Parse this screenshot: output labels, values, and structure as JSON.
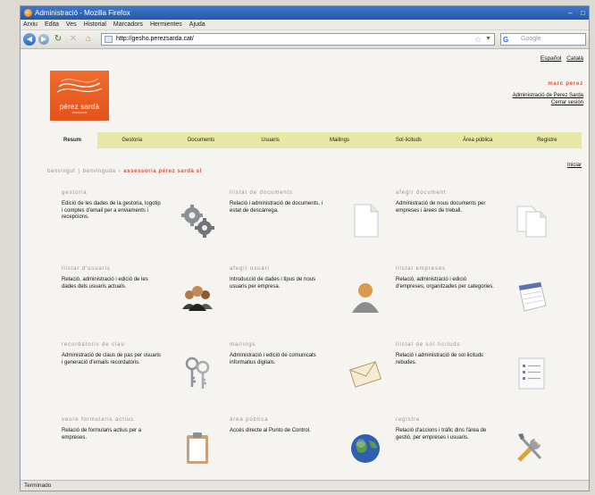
{
  "browser": {
    "title": "Administració - Mozilla Firefox",
    "menu": [
      "Arxiu",
      "Edita",
      "Ves",
      "Historial",
      "Marcadors",
      "Hermientes",
      "Ajuda"
    ],
    "url": "http://gesho.perezsarda.cat/",
    "search_placeholder": "Google",
    "status": "Terminado"
  },
  "header": {
    "logo_name": "pérez sardà",
    "logo_sub": "assessoria",
    "lang_es": "Español",
    "lang_ca": "Català",
    "user": "marc perez",
    "admin_link": "Administració de Perez Sarda",
    "logout": "Cerrar sesión"
  },
  "tabs": [
    "Resum",
    "Gestoria",
    "Documents",
    "Usuaris",
    "Mailings",
    "Sol·licituds",
    "Àrea pública",
    "Registre"
  ],
  "breadcrumb": {
    "items": [
      "benvingut",
      "benvinguda"
    ],
    "current": "assessoria pérez sardà sl"
  },
  "iniciar": "Iniciar",
  "cards": [
    {
      "title": "gestoria",
      "desc": "Edició de les dades de la gestoria, logotip i comptes d'email per a enviaments i recepcions.",
      "icon": "gears-icon"
    },
    {
      "title": "llistat de documents",
      "desc": "Relació i administració de documents, i estat de descàrrega.",
      "icon": "document-icon"
    },
    {
      "title": "afegir document",
      "desc": "Administració de nous documents per empreses i àrees de treball.",
      "icon": "documents-icon"
    },
    {
      "title": "llistar d'usuaris",
      "desc": "Relació, administració i edició de les dades dels usuaris actuals.",
      "icon": "users-group-icon"
    },
    {
      "title": "afegir usuari",
      "desc": "Introducció de dades i tipus de nous usuaris per empresa.",
      "icon": "user-icon"
    },
    {
      "title": "llistat empreses",
      "desc": "Relació, administració i edició d'empreses, organitzades per categories.",
      "icon": "notepad-icon"
    },
    {
      "title": "recordatoris de clau",
      "desc": "Administració de claus de pas per usuaris i generació d'emails recordatoris.",
      "icon": "keys-icon"
    },
    {
      "title": "mailings",
      "desc": "Administració i edició de comunicats informatius digitals.",
      "icon": "envelope-icon"
    },
    {
      "title": "llistat de sol·licituds",
      "desc": "Relació i administració de sol·licituds rebudes.",
      "icon": "list-icon"
    },
    {
      "title": "veure formularis actius",
      "desc": "Relació de formularis actius per a empreses.",
      "icon": "clipboard-icon"
    },
    {
      "title": "àrea pública",
      "desc": "Accés directe al Punto de Control.",
      "icon": "globe-icon"
    },
    {
      "title": "registre",
      "desc": "Relació d'accions i tràfic dins l'àrea de gestió, per empreses i usuaris.",
      "icon": "tools-icon"
    }
  ]
}
